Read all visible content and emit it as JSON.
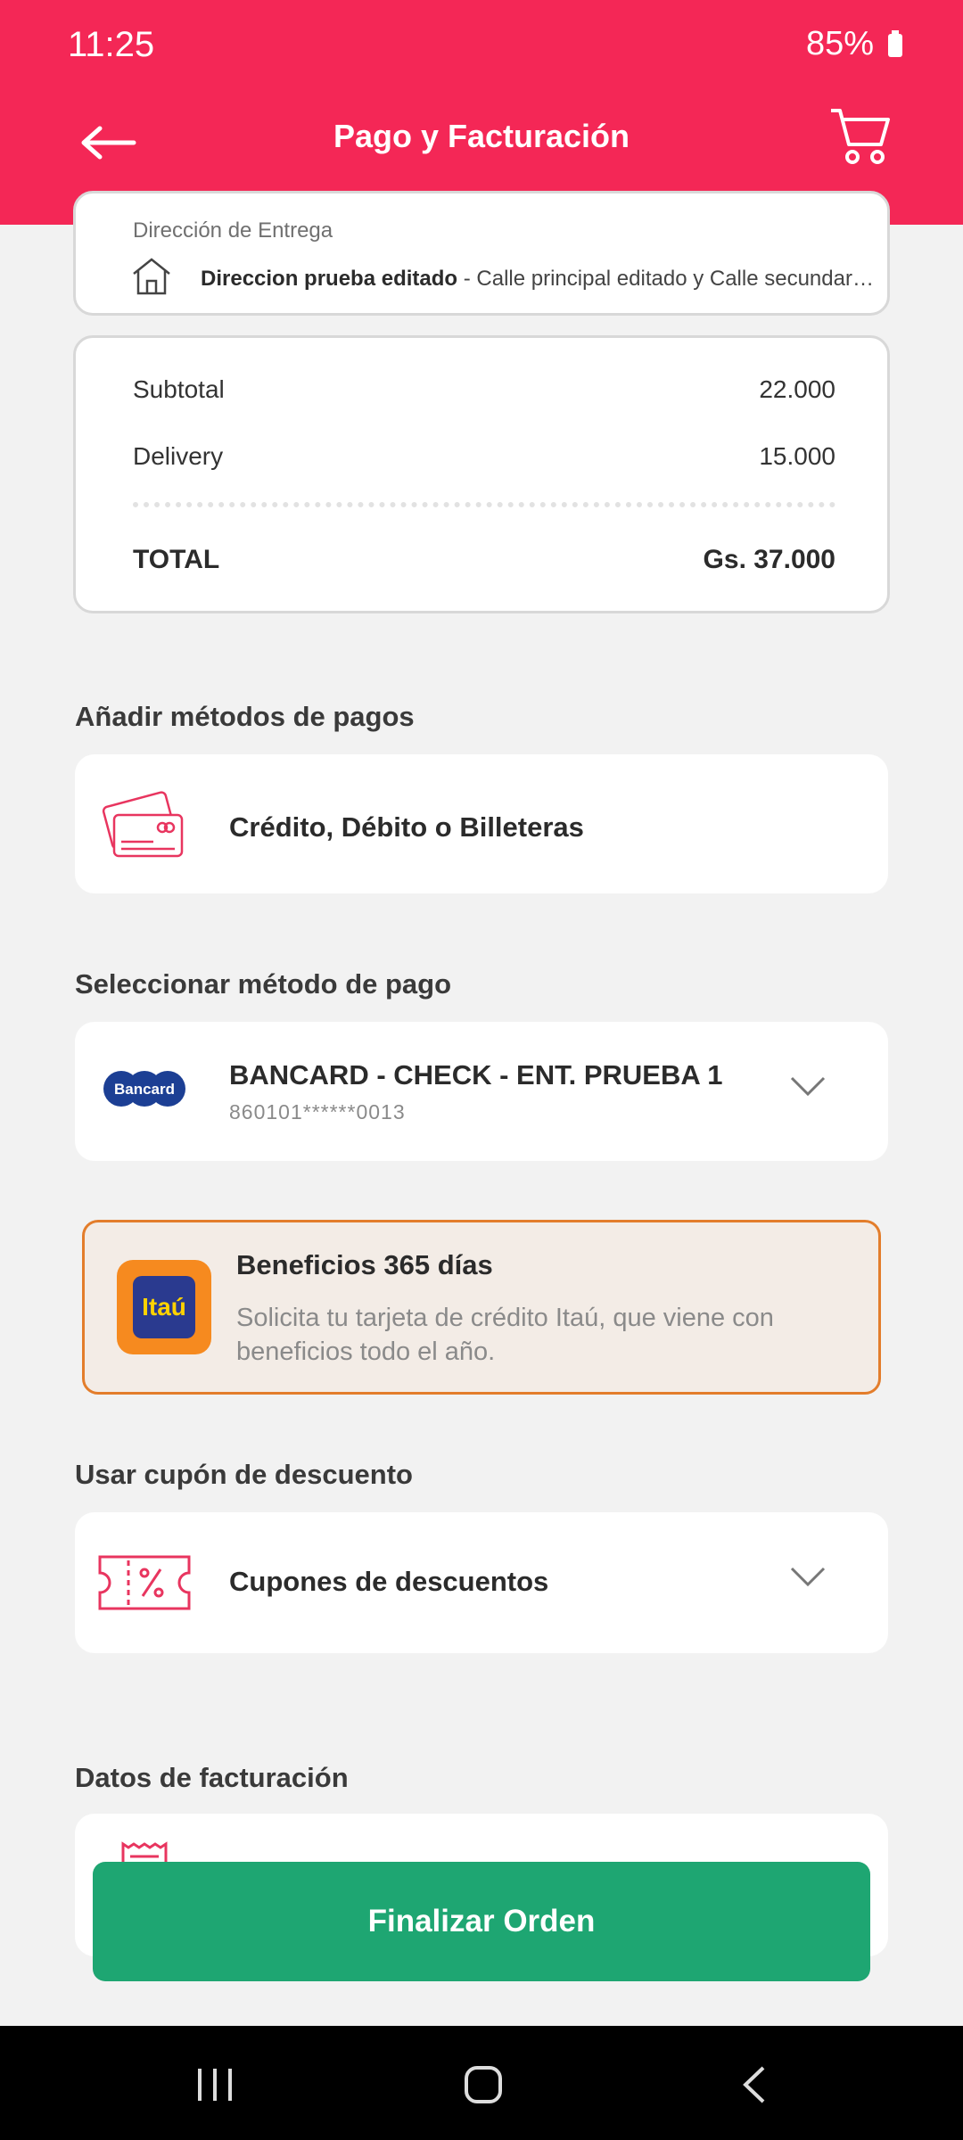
{
  "status_bar": {
    "time": "11:25",
    "battery": "85%"
  },
  "header": {
    "title": "Pago y Facturación"
  },
  "address": {
    "label": "Dirección de Entrega",
    "name": "Direccion prueba editado",
    "detail": " - Calle principal editado y Calle secundaria editado"
  },
  "summary": {
    "subtotal_label": "Subtotal",
    "subtotal_value": "22.000",
    "delivery_label": "Delivery",
    "delivery_value": "15.000",
    "total_label": "TOTAL",
    "total_value": "Gs. 37.000"
  },
  "add_payment": {
    "section_title": "Añadir métodos de pagos",
    "option_label": "Crédito, Débito o Billeteras"
  },
  "select_payment": {
    "section_title": "Seleccionar método de pago",
    "brand_text": "Bancard",
    "selected_name": "BANCARD - CHECK - ENT. PRUEBA 1",
    "selected_number": "860101******0013"
  },
  "promo": {
    "logo_text": "Itaú",
    "title": "Beneficios 365 días",
    "description": "Solicita tu tarjeta de crédito Itaú, que viene con beneficios todo el año."
  },
  "coupon": {
    "section_title": "Usar cupón de descuento",
    "option_label": "Cupones de descuentos"
  },
  "billing": {
    "section_title": "Datos de facturación"
  },
  "actions": {
    "finalize_label": "Finalizar Orden"
  },
  "colors": {
    "brand": "#f42756",
    "accent_green": "#1ea672",
    "promo_border": "#e37d2b"
  }
}
